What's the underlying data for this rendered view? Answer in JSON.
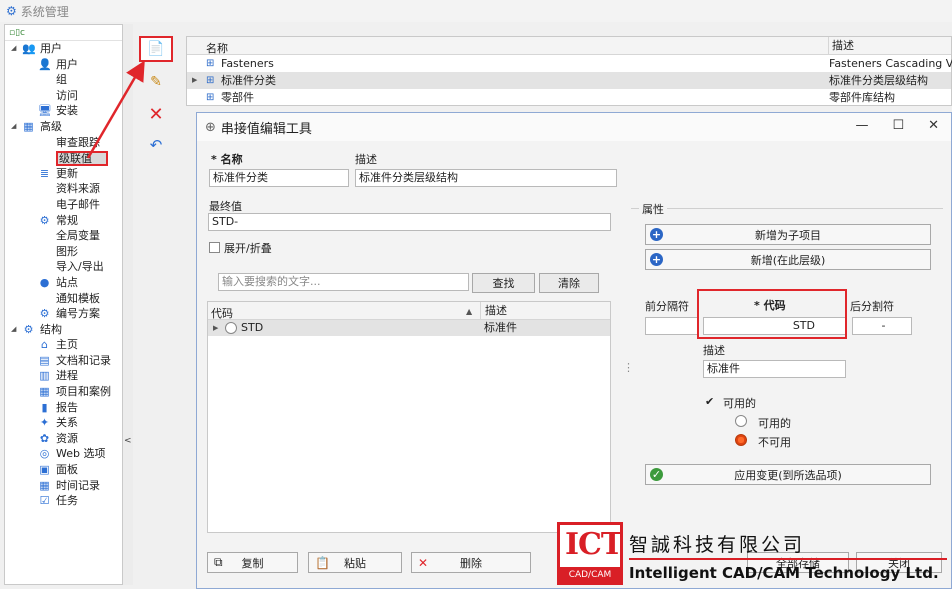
{
  "window": {
    "title": "系统管理"
  },
  "tree": {
    "items": [
      {
        "label": "用户",
        "level": 0,
        "expanded": true,
        "icon": "users-icon",
        "glyph": "👥"
      },
      {
        "label": "用户",
        "level": 1,
        "icon": "user-icon",
        "glyph": "👤"
      },
      {
        "label": "组",
        "level": 1,
        "icon": "",
        "glyph": ""
      },
      {
        "label": "访问",
        "level": 1,
        "icon": "",
        "glyph": ""
      },
      {
        "label": "安装",
        "level": 1,
        "icon": "monitor-icon",
        "glyph": "🖥"
      },
      {
        "label": "高级",
        "level": 0,
        "expanded": true,
        "icon": "advanced-icon",
        "glyph": "▦"
      },
      {
        "label": "审查跟踪",
        "level": 1,
        "icon": "",
        "glyph": ""
      },
      {
        "label": "级联值",
        "level": 1,
        "icon": "",
        "glyph": "",
        "selected": true
      },
      {
        "label": "更新",
        "level": 1,
        "icon": "database-icon",
        "glyph": "≣"
      },
      {
        "label": "资料来源",
        "level": 1,
        "icon": "",
        "glyph": ""
      },
      {
        "label": "电子邮件",
        "level": 1,
        "icon": "",
        "glyph": ""
      },
      {
        "label": "常规",
        "level": 1,
        "icon": "gear-icon",
        "glyph": "⚙"
      },
      {
        "label": "全局变量",
        "level": 1,
        "icon": "",
        "glyph": ""
      },
      {
        "label": "图形",
        "level": 1,
        "icon": "",
        "glyph": ""
      },
      {
        "label": "导入/导出",
        "level": 1,
        "icon": "",
        "glyph": ""
      },
      {
        "label": "站点",
        "level": 1,
        "icon": "globe-icon",
        "glyph": "●"
      },
      {
        "label": "通知模板",
        "level": 1,
        "icon": "",
        "glyph": ""
      },
      {
        "label": "编号方案",
        "level": 1,
        "icon": "gear-icon",
        "glyph": "⚙"
      },
      {
        "label": "结构",
        "level": 0,
        "expanded": true,
        "icon": "structure-icon",
        "glyph": "⚙"
      },
      {
        "label": "主页",
        "level": 1,
        "icon": "home-icon",
        "glyph": "⌂"
      },
      {
        "label": "文档和记录",
        "level": 1,
        "icon": "document-icon",
        "glyph": "▤"
      },
      {
        "label": "进程",
        "level": 1,
        "icon": "process-icon",
        "glyph": "▥"
      },
      {
        "label": "项目和案例",
        "level": 1,
        "icon": "project-icon",
        "glyph": "▦"
      },
      {
        "label": "报告",
        "level": 1,
        "icon": "report-icon",
        "glyph": "▮"
      },
      {
        "label": "关系",
        "level": 1,
        "icon": "relation-icon",
        "glyph": "✦"
      },
      {
        "label": "资源",
        "level": 1,
        "icon": "resource-icon",
        "glyph": "✿"
      },
      {
        "label": "Web 选项",
        "level": 1,
        "icon": "web-icon",
        "glyph": "◎"
      },
      {
        "label": "面板",
        "level": 1,
        "icon": "panel-icon",
        "glyph": "▣"
      },
      {
        "label": "时间记录",
        "level": 1,
        "icon": "clock-icon",
        "glyph": "▦"
      },
      {
        "label": "任务",
        "level": 1,
        "icon": "task-icon",
        "glyph": "☑"
      }
    ]
  },
  "collapse_glyph": "<",
  "toolbar": {
    "new_glyph": "📄",
    "edit_glyph": "✎",
    "delete_glyph": "✕",
    "undo_glyph": "↶"
  },
  "grid": {
    "col_name": "名称",
    "col_desc": "描述",
    "rows": [
      {
        "name": "Fasteners",
        "desc": "Fasteners Cascading Value"
      },
      {
        "name": "标准件分类",
        "desc": "标准件分类层级结构",
        "active": true
      },
      {
        "name": "零部件",
        "desc": "零部件库结构"
      }
    ]
  },
  "dialog": {
    "title": "串接值编辑工具",
    "win_min": "—",
    "win_max": "☐",
    "win_close": "✕",
    "name_label": "* 名称",
    "name_value": "标准件分类",
    "desc_label": "描述",
    "desc_value": "标准件分类层级结构",
    "final_label": "最终值",
    "final_value": "STD-",
    "expand_label": "展开/折叠",
    "search_placeholder": "输入要搜索的文字...",
    "find_label": "查找",
    "clear_label": "清除",
    "code_col": "代码",
    "code_desc_col": "描述",
    "sort_glyph": "▲",
    "code_row": {
      "code": "STD",
      "desc": "标准件"
    },
    "copy_label": "复制",
    "paste_label": "粘贴",
    "delete_label": "删除",
    "save_all_label": "全部存储",
    "close_label": "关闭",
    "splitter_glyph": "⋮",
    "props": {
      "group_label": "属性",
      "add_child_label": "新增为子项目",
      "add_same_label": "新增(在此层级)",
      "prefix_label": "前分隔符",
      "code_label": "* 代码",
      "suffix_label": "后分割符",
      "prefix_value": "",
      "code_value": "STD",
      "suffix_value": "-",
      "desc_label": "描述",
      "desc_value": "标准件",
      "available_label": "可用的",
      "radio_available": "可用的",
      "radio_unavailable": "不可用",
      "apply_label": "应用变更(到所选品项)"
    }
  },
  "watermark": {
    "logo_text": "ICT",
    "logo_sub": "CAD/CAM",
    "company_cn": "智誠科技有限公司",
    "company_en": "Intelligent CAD/CAM Technology Ltd."
  }
}
